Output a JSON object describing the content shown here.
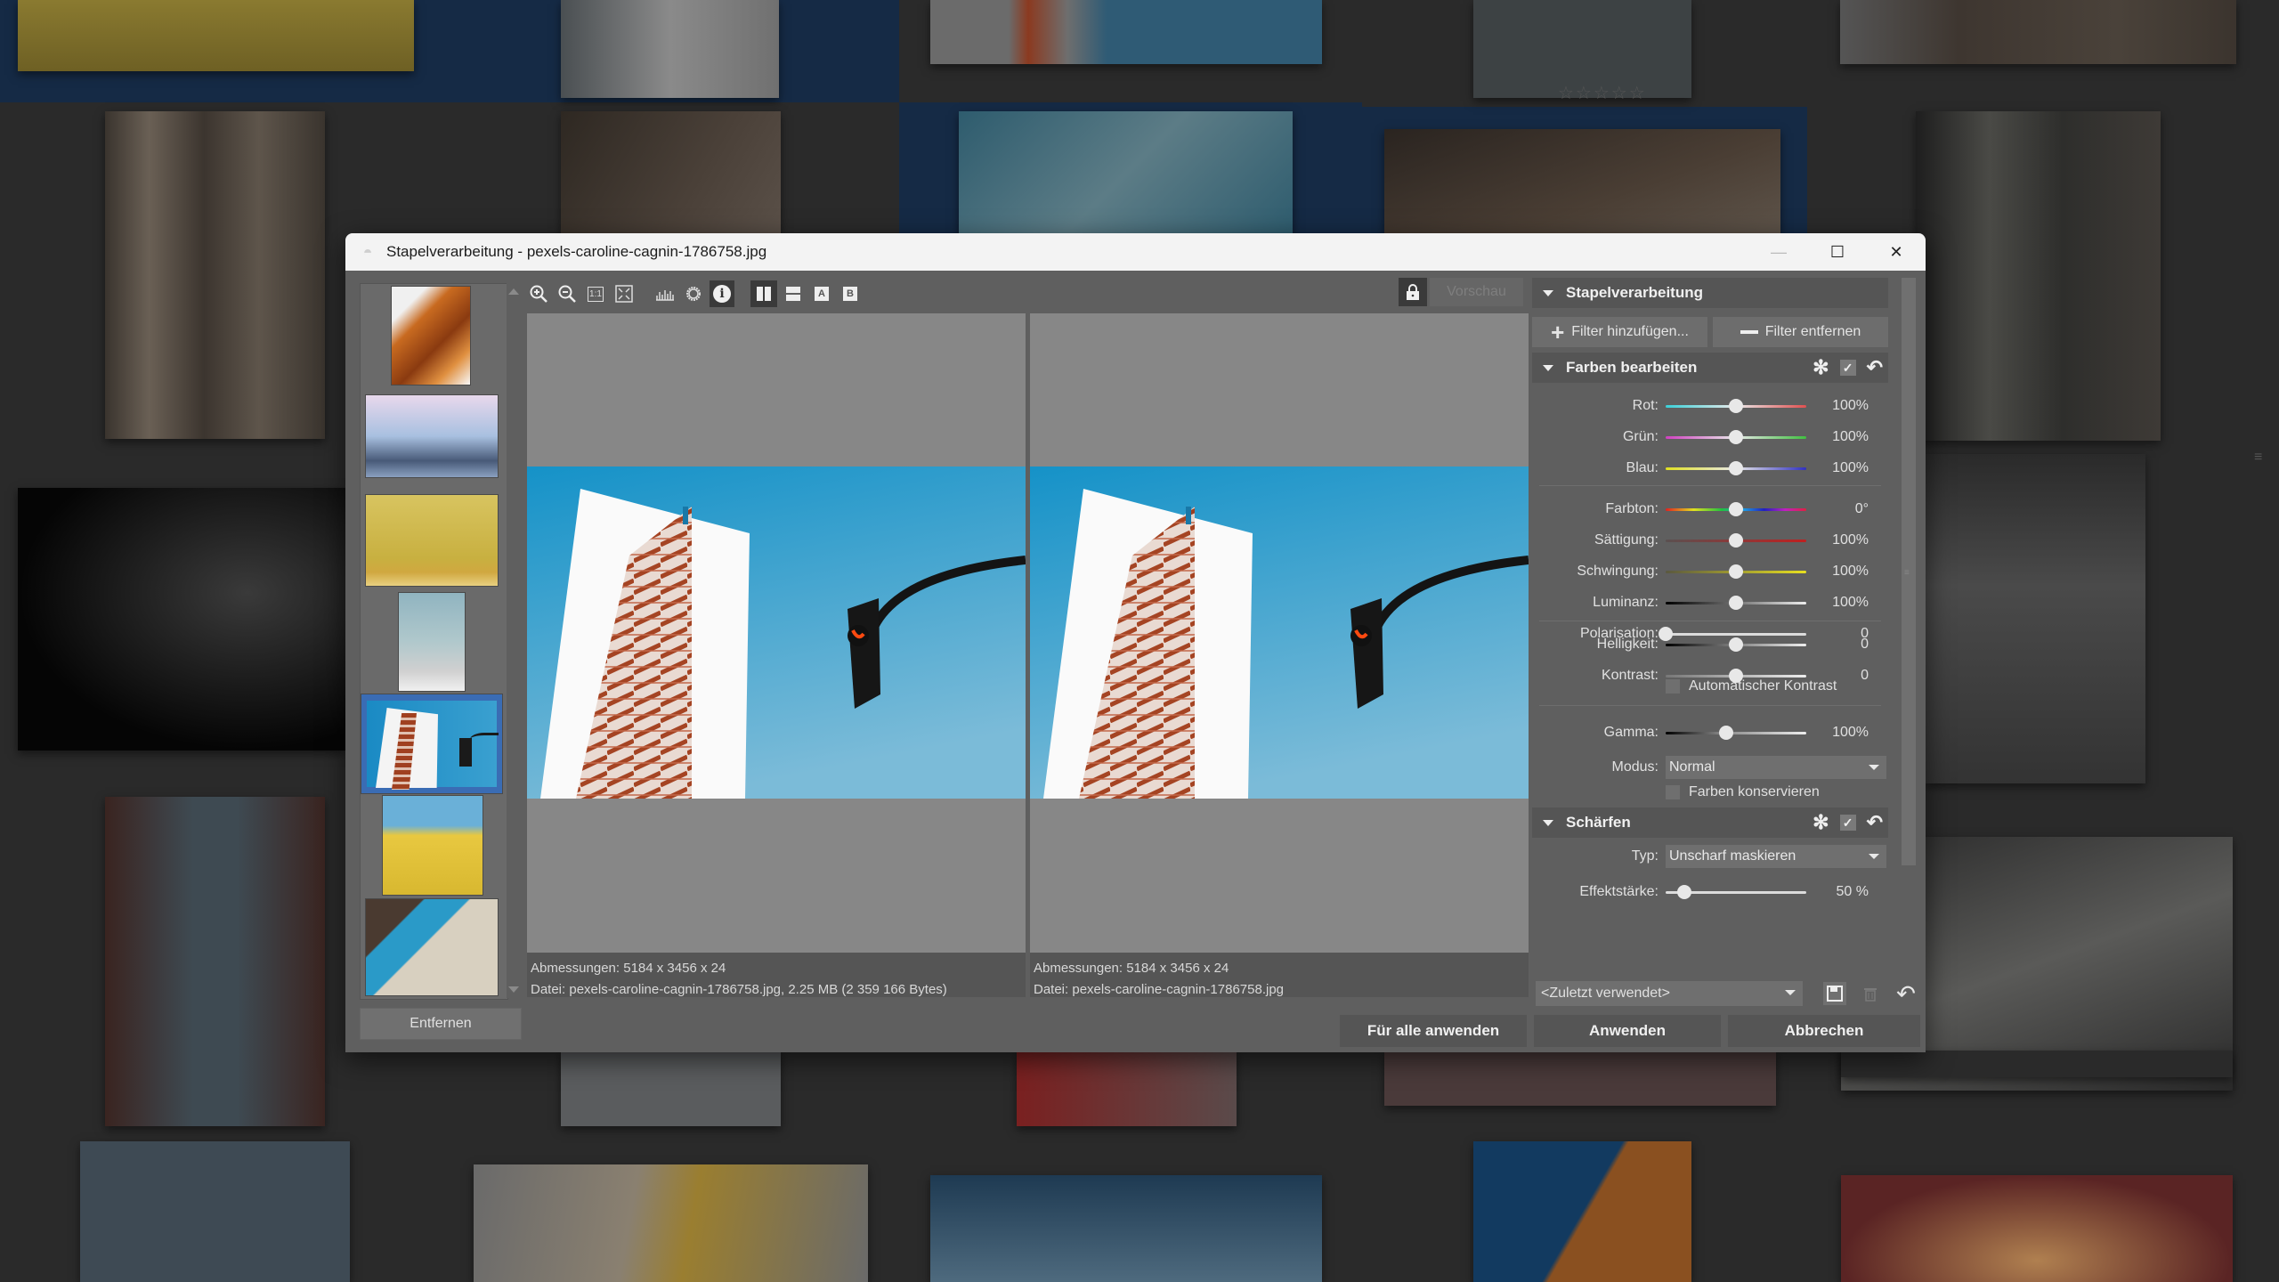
{
  "background": {
    "rating_stars": "☆☆☆☆☆",
    "colors": {
      "canvas": "#2a2a2a",
      "selected_tile_bg": "#152a45"
    }
  },
  "dialog": {
    "title": "Stapelverarbeitung - pexels-caroline-cagnin-1786758.jpg",
    "window_controls": {
      "minimize": "—",
      "maximize": "☐",
      "close": "✕"
    },
    "thumbnails": {
      "selected_index": 4,
      "items": [
        {
          "name": "orange-spiral-staircase"
        },
        {
          "name": "lotus-temple"
        },
        {
          "name": "yellow-wall-wave"
        },
        {
          "name": "white-tower-sky"
        },
        {
          "name": "building-traffic-light"
        },
        {
          "name": "yellow-building-clouds"
        },
        {
          "name": "concrete-overhang"
        }
      ],
      "remove_label": "Entfernen"
    },
    "toolbar": {
      "zoom_in": "zoom-in",
      "zoom_out": "zoom-out",
      "actual_size": "1:1",
      "fit": "fit-to-window",
      "histogram": "histogram",
      "exposure": "exposure",
      "info": "i",
      "split_vertical": "split-vertical",
      "split_horizontal": "split-horizontal",
      "view_a": "A",
      "view_b": "B",
      "preview_label": "Vorschau"
    },
    "preview": {
      "left": {
        "dimensions": "Abmessungen: 5184 x 3456 x 24",
        "file": "Datei: pexels-caroline-cagnin-1786758.jpg, 2.25 MB (2 359 166 Bytes)"
      },
      "right": {
        "dimensions": "Abmessungen: 5184 x 3456 x 24",
        "file": "Datei: pexels-caroline-cagnin-1786758.jpg"
      }
    },
    "panel": {
      "batch_header": "Stapelverarbeitung",
      "add_filter": "Filter hinzufügen...",
      "remove_filter": "Filter entfernen",
      "colors_section": {
        "title": "Farben bearbeiten",
        "sliders_a": [
          {
            "label": "Rot:",
            "value": "100%",
            "pos": 0.5
          },
          {
            "label": "Grün:",
            "value": "100%",
            "pos": 0.5
          },
          {
            "label": "Blau:",
            "value": "100%",
            "pos": 0.5
          }
        ],
        "sliders_b": [
          {
            "label": "Farbton:",
            "value": "0°",
            "pos": 0.5
          },
          {
            "label": "Sättigung:",
            "value": "100%",
            "pos": 0.5
          },
          {
            "label": "Schwingung:",
            "value": "100%",
            "pos": 0.5
          },
          {
            "label": "Luminanz:",
            "value": "100%",
            "pos": 0.5
          },
          {
            "label": "Polarisation:",
            "value": "0",
            "pos": 0.0
          }
        ],
        "sliders_c": [
          {
            "label": "Helligkeit:",
            "value": "0",
            "pos": 0.5
          },
          {
            "label": "Kontrast:",
            "value": "0",
            "pos": 0.5
          }
        ],
        "auto_contrast_label": "Automatischer Kontrast",
        "auto_contrast_checked": false,
        "gamma": {
          "label": "Gamma:",
          "value": "100%",
          "pos": 0.43
        },
        "mode": {
          "label": "Modus:",
          "value": "Normal"
        },
        "preserve_colors_label": "Farben konservieren",
        "preserve_colors_checked": false,
        "enabled": true
      },
      "sharpen_section": {
        "title": "Schärfen",
        "type": {
          "label": "Typ:",
          "value": "Unscharf maskieren"
        },
        "strength": {
          "label": "Effektstärke:",
          "value": "50 %",
          "pos": 0.13
        },
        "enabled": true
      }
    },
    "preset": {
      "value": "<Zuletzt verwendet>"
    },
    "footer": {
      "apply_all": "Für alle anwenden",
      "apply": "Anwenden",
      "cancel": "Abbrechen"
    }
  }
}
